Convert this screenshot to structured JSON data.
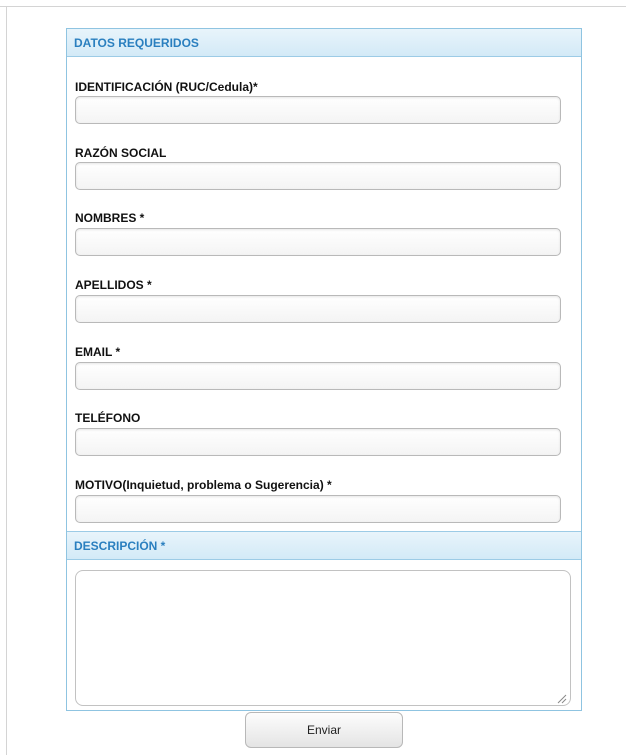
{
  "form": {
    "section_required": "DATOS REQUERIDOS",
    "fields": [
      {
        "label": "IDENTIFICACIÓN (RUC/Cedula)*",
        "value": ""
      },
      {
        "label": "RAZÓN SOCIAL",
        "value": ""
      },
      {
        "label": "NOMBRES *",
        "value": ""
      },
      {
        "label": "APELLIDOS *",
        "value": ""
      },
      {
        "label": "EMAIL *",
        "value": ""
      },
      {
        "label": "TELÉFONO",
        "value": ""
      },
      {
        "label": "MOTIVO(Inquietud, problema o Sugerencia) *",
        "value": ""
      }
    ],
    "section_description": "DESCRIPCIÓN *",
    "description_value": "",
    "submit_label": "Enviar"
  },
  "colors": {
    "header_text": "#2a7fbf",
    "header_bg": "#d3eaf7",
    "border": "#8fc4e1"
  },
  "icons": {
    "resize_handle": "resize-grip-icon"
  }
}
